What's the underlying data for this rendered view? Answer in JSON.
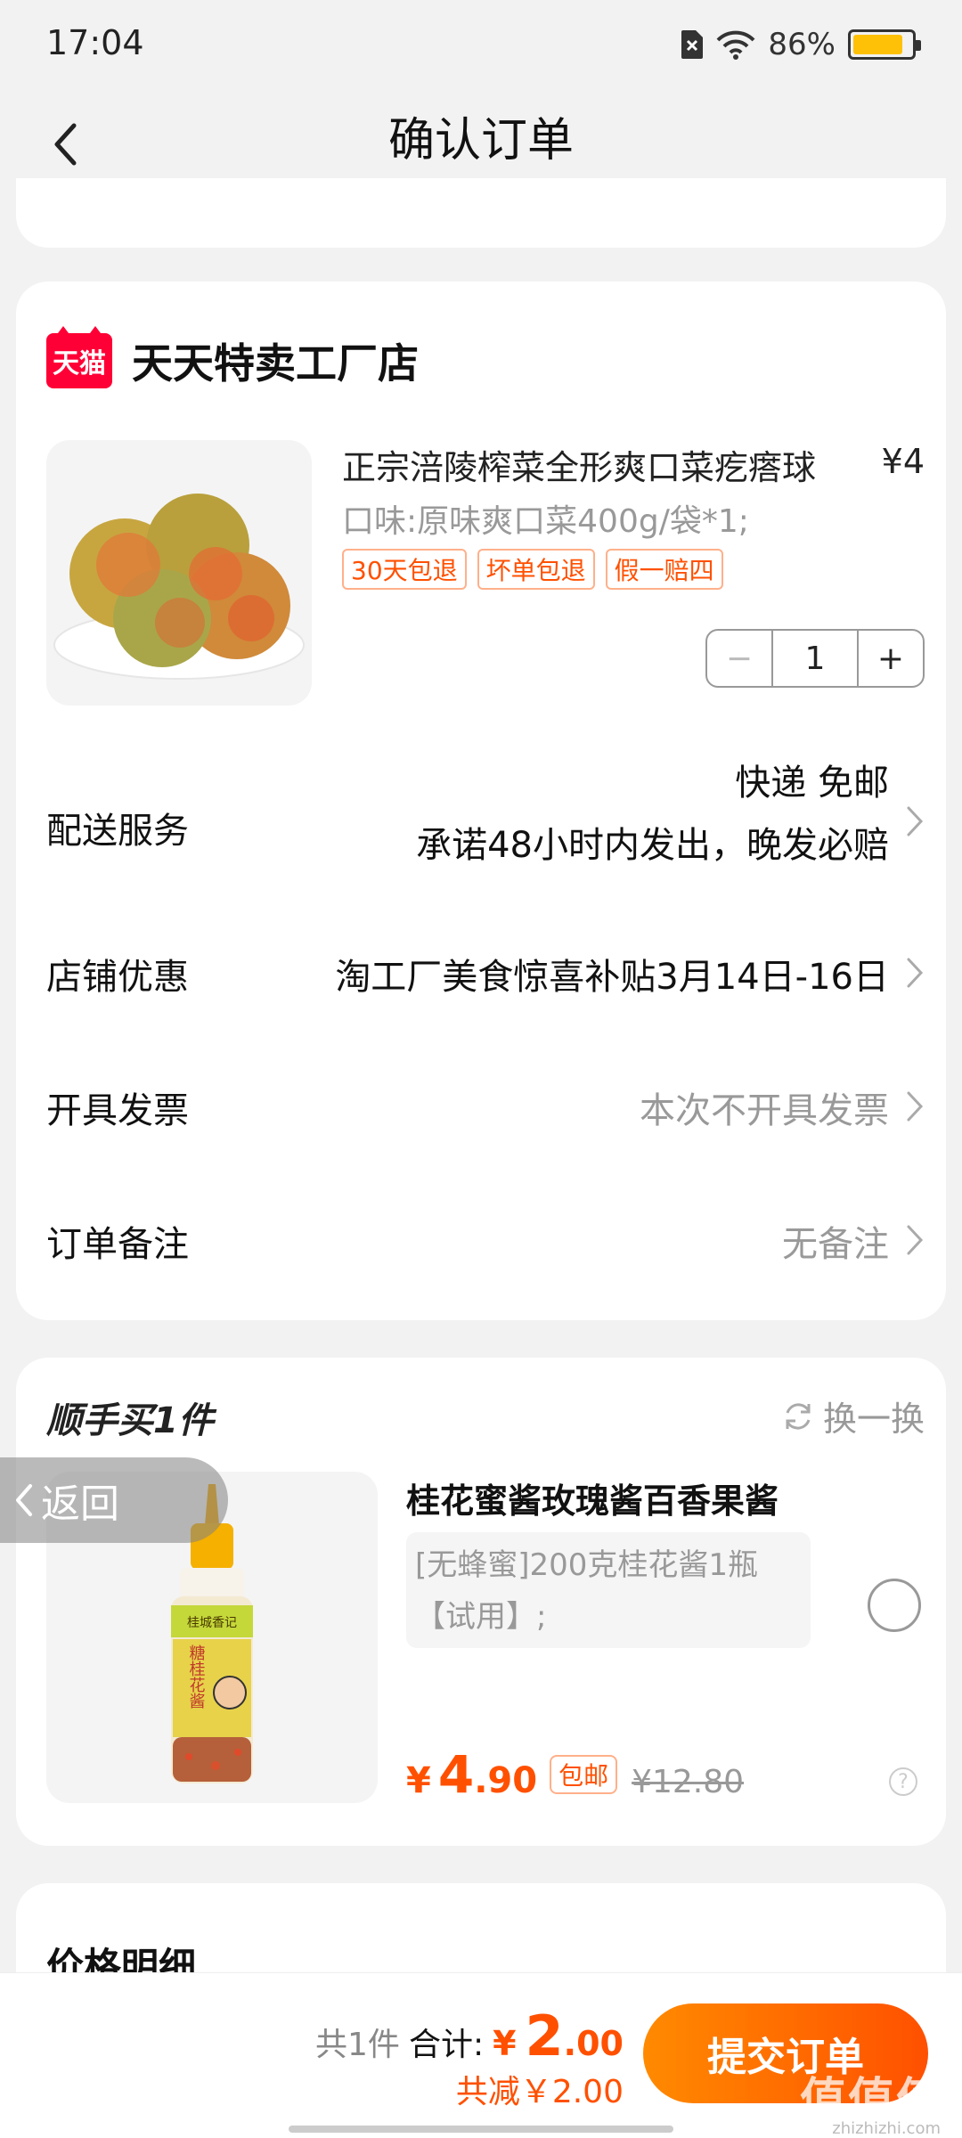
{
  "status_bar": {
    "time": "17:04",
    "battery_text": "86%",
    "battery_level": 0.86
  },
  "header": {
    "title": "确认订单"
  },
  "shop": {
    "logo_text": "天猫",
    "name": "天天特卖工厂店",
    "product": {
      "title": "正宗涪陵榨菜全形爽口菜疙瘩球",
      "price": "¥4",
      "spec": "口味:原味爽口菜400g/袋*1;",
      "tags": [
        "30天包退",
        "坏单包退",
        "假一赔四"
      ],
      "quantity": "1",
      "minus": "−",
      "plus": "+"
    },
    "delivery": {
      "label": "配送服务",
      "value_line1": "快递 免邮",
      "value_line2": "承诺48小时内发出，晚发必赔"
    },
    "discount": {
      "label": "店铺优惠",
      "value": "淘工厂美食惊喜补贴3月14日-16日"
    },
    "invoice": {
      "label": "开具发票",
      "value": "本次不开具发票"
    },
    "remark": {
      "label": "订单备注",
      "value": "无备注"
    }
  },
  "addon": {
    "title": "顺手买1件",
    "swap_label": "换一换",
    "product": {
      "name": "桂花蜜酱玫瑰酱百香果酱",
      "spec_line1": "[无蜂蜜]200克桂花酱1瓶",
      "spec_line2": "【试用】;",
      "price_currency": "¥",
      "price_int": "4",
      "price_dec": ".90",
      "free_shipping": "包邮",
      "original_price": "¥12.80",
      "help": "?",
      "bottle_label_top": "桂城香记",
      "bottle_label_main": "糖桂花酱"
    }
  },
  "floating_back": {
    "label": "返回"
  },
  "price_detail": {
    "title": "价格明细"
  },
  "bottom_bar": {
    "count": "共1件",
    "total_label": "合计:",
    "total_currency": "¥",
    "total_int": "2",
    "total_dec": ".00",
    "discount_text": "共减￥2.00",
    "submit_label": "提交订单",
    "watermark": "值值值",
    "watermark_url": "zhizhizhi.com"
  },
  "colors": {
    "accent": "#ff5000",
    "tmall_red": "#ff0036",
    "background": "#f2f2f2"
  }
}
